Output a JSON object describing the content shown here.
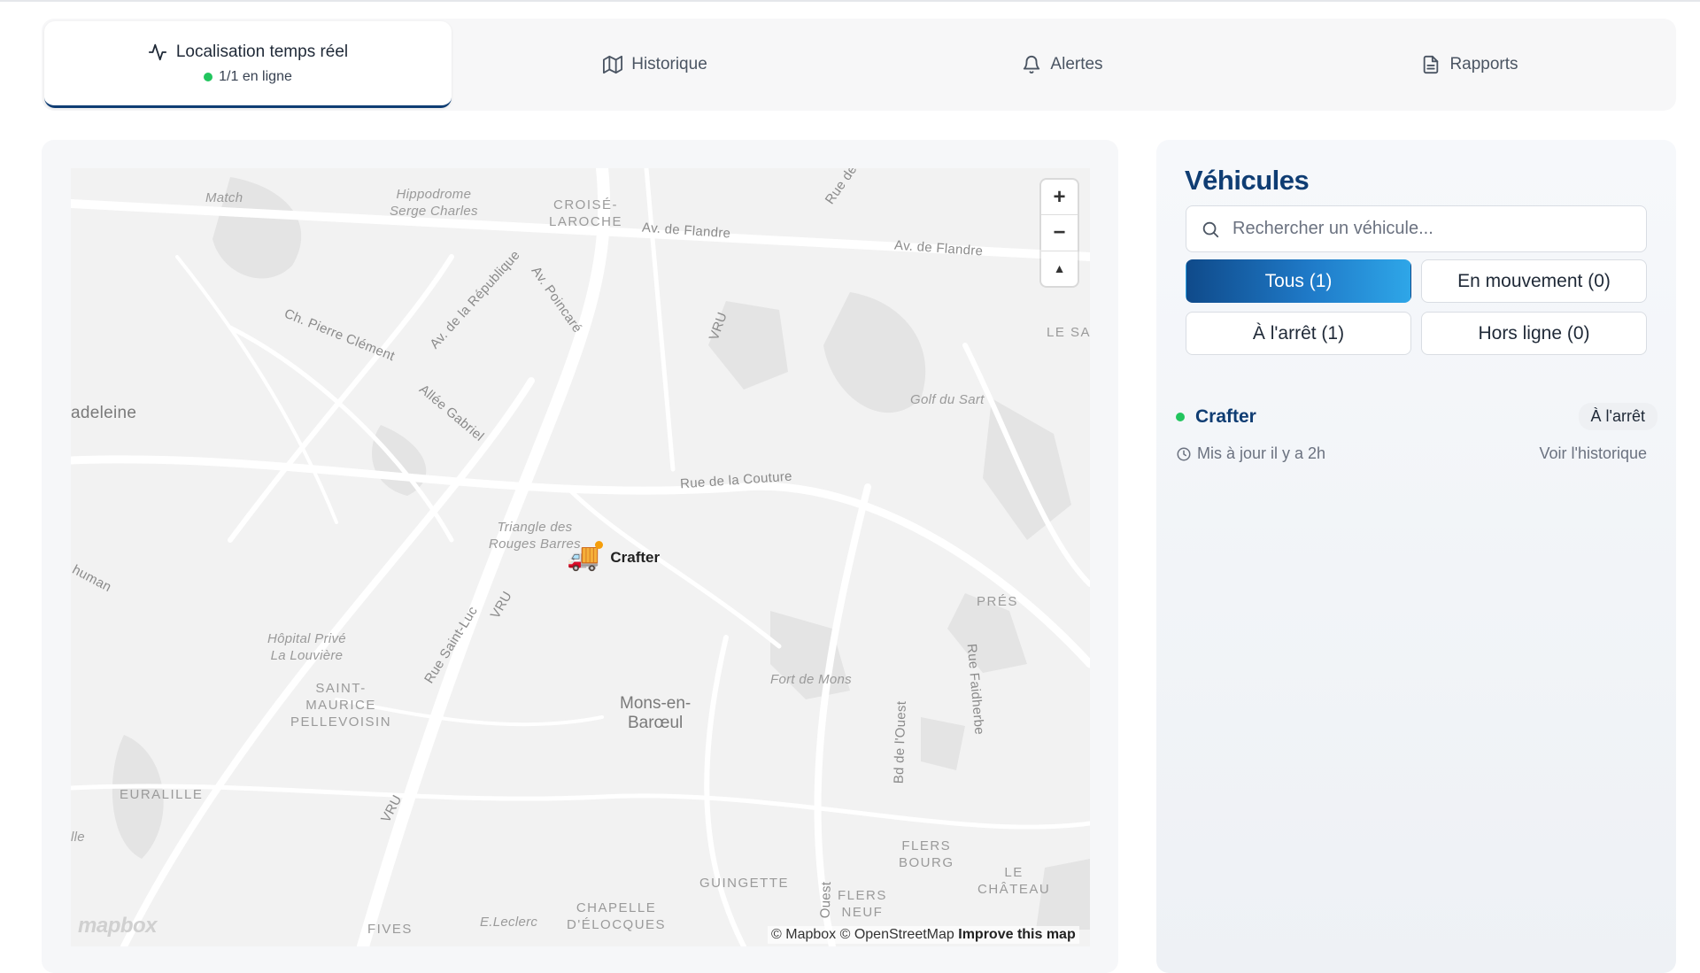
{
  "tabs": [
    {
      "label": "Localisation temps réel",
      "icon": "activity-icon",
      "sub": "1/1 en ligne",
      "active": true
    },
    {
      "label": "Historique",
      "icon": "map-icon",
      "active": false
    },
    {
      "label": "Alertes",
      "icon": "bell-icon",
      "active": false
    },
    {
      "label": "Rapports",
      "icon": "document-icon",
      "active": false
    }
  ],
  "map": {
    "labels": {
      "match": "Match",
      "hippodrome": "Hippodrome\nSerge Charles",
      "croise": "CROISÉ-\nLAROCHE",
      "avflandre1": "Av. de Flandre",
      "avflandre2": "Av. de Flandre",
      "ruede": "Rue de",
      "lesa": "LE SA",
      "chpierre": "Ch. Pierre Clément",
      "avrepublique": "Av. de la République",
      "avpoincare": "Av. Poincaré",
      "vru1": "VRU",
      "vru2": "VRU",
      "vru3": "VRU",
      "madeleine": "adeleine",
      "alleegabriel": "Allée Gabriel",
      "golf": "Golf du Sart",
      "couture": "Rue de la Couture",
      "triangle": "Triangle des\nRouges Barres",
      "human": "human",
      "pres": "PRÉS",
      "hopital": "Hôpital Privé\nLa Louvière",
      "saintluc": "Rue Saint-Luc",
      "saintmaurice": "SAINT-\nMAURICE\nPELLEVOISIN",
      "fortmons": "Fort de Mons",
      "faidherbe": "Rue Faidherbe",
      "mons": "Mons-en-\nBarœul",
      "bdouest": "Bd de l'Ouest",
      "euralille": "EURALILLE",
      "lille": "lle",
      "flersbourg": "FLERS\nBOURG",
      "lechateau": "LE\nCHÂTEAU",
      "guinguette": "GUINGETTE",
      "flersneuf": "FLERS\nNEUF",
      "chapelle": "CHAPELLE\nD'ÉLOCQUES",
      "eleclerc": "E.Leclerc",
      "fives": "FIVES",
      "ouest": "Ouest"
    },
    "zoom_in": "+",
    "zoom_out": "−",
    "compass": "▲",
    "marker_name": "Crafter",
    "attribution_a": "© Mapbox © OpenStreetMap",
    "attribution_b": "Improve this map",
    "logo": "mapbox"
  },
  "panel": {
    "title": "Véhicules",
    "search_placeholder": "Rechercher un véhicule...",
    "filters": {
      "all": "Tous (1)",
      "moving": "En mouvement (0)",
      "stopped": "À l'arrêt (1)",
      "offline": "Hors ligne (0)"
    },
    "vehicle": {
      "name": "Crafter",
      "status": "À l'arrêt",
      "updated": "Mis à jour il y a 2h",
      "history_link": "Voir l'historique",
      "status_color": "#22c55e"
    }
  },
  "colors": {
    "brand": "#0f3d73",
    "online": "#22c55e",
    "accent": "#2ea6e8"
  }
}
